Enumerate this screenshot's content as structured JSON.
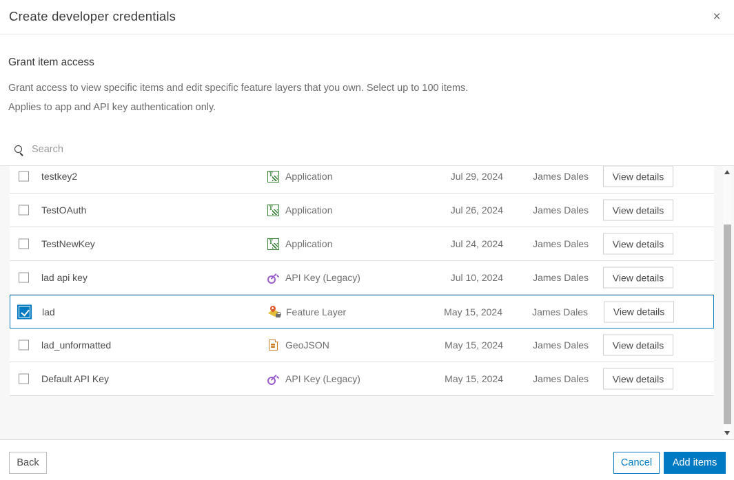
{
  "dialog": {
    "title": "Create developer credentials",
    "close_label": "×"
  },
  "intro": {
    "heading": "Grant item access",
    "line1": "Grant access to view specific items and edit specific feature layers that you own. Select up to 100 items.",
    "line2": "Applies to app and API key authentication only."
  },
  "search": {
    "placeholder": "Search"
  },
  "table": {
    "view_details_label": "View details",
    "rows": [
      {
        "name": "testkey2",
        "type": "Application",
        "icon": "application",
        "date": "Jul 29, 2024",
        "owner": "James Dales",
        "checked": false,
        "selected": false
      },
      {
        "name": "TestOAuth",
        "type": "Application",
        "icon": "application",
        "date": "Jul 26, 2024",
        "owner": "James Dales",
        "checked": false,
        "selected": false
      },
      {
        "name": "TestNewKey",
        "type": "Application",
        "icon": "application",
        "date": "Jul 24, 2024",
        "owner": "James Dales",
        "checked": false,
        "selected": false
      },
      {
        "name": "lad api key",
        "type": "API Key (Legacy)",
        "icon": "apikey",
        "date": "Jul 10, 2024",
        "owner": "James Dales",
        "checked": false,
        "selected": false
      },
      {
        "name": "lad",
        "type": "Feature Layer",
        "icon": "featurelayer",
        "date": "May 15, 2024",
        "owner": "James Dales",
        "checked": true,
        "selected": true
      },
      {
        "name": "lad_unformatted",
        "type": "GeoJSON",
        "icon": "geojson",
        "date": "May 15, 2024",
        "owner": "James Dales",
        "checked": false,
        "selected": false
      },
      {
        "name": "Default API Key",
        "type": "API Key (Legacy)",
        "icon": "apikey",
        "date": "May 15, 2024",
        "owner": "James Dales",
        "checked": false,
        "selected": false
      }
    ]
  },
  "footer": {
    "back_label": "Back",
    "cancel_label": "Cancel",
    "add_items_label": "Add items"
  },
  "colors": {
    "accent": "#007ac2",
    "application_green": "#338033",
    "api_key_purple": "#9a5ccd",
    "geojson_orange": "#ca7a1c",
    "feature_layer_yellow": "#e2bf36",
    "feature_layer_pin": "#e05a2b"
  }
}
